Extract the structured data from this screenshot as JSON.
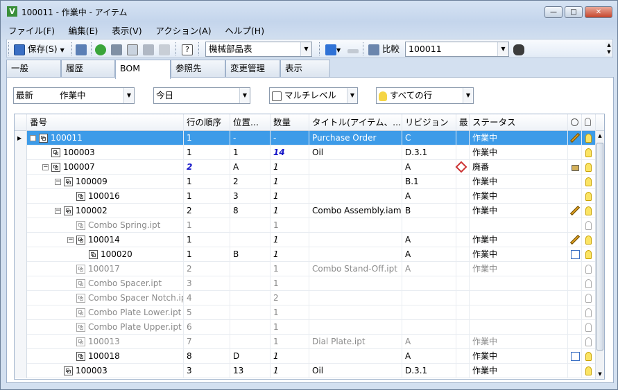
{
  "window": {
    "title": "100011 - 作業中 - アイテム",
    "app_icon": "V",
    "minimize": "—",
    "maximize": "□",
    "close": "✕"
  },
  "menu": [
    "ファイル(F)",
    "編集(E)",
    "表示(V)",
    "アクション(A)",
    "ヘルプ(H)"
  ],
  "toolbar": {
    "save_label": "保存(S)",
    "bom_view": "機械部品表",
    "compare_label": "比較",
    "compare_value": "100011"
  },
  "tabs": [
    "一般",
    "履歴",
    "BOM",
    "参照先",
    "変更管理",
    "表示"
  ],
  "active_tab": "BOM",
  "filters": {
    "revision": "最新",
    "state": "作業中",
    "date": "今日",
    "level": "マルチレベル",
    "rows": "すべての行"
  },
  "columns": [
    "番号",
    "行の順序",
    "位置...",
    "数量",
    "タイトル(アイテム、...",
    "リビジョン",
    "最",
    "ステータス"
  ],
  "rows": [
    {
      "number": "100011",
      "order": "1",
      "pos": "-",
      "qty": "-",
      "title": "Purchase Order",
      "rev": "C",
      "status": "作業中",
      "level": 0,
      "expand": "⊟",
      "selected": true,
      "style": "normal",
      "edit": true,
      "bulb": "on"
    },
    {
      "number": "100003",
      "order": "1",
      "pos": "1",
      "qty": "14",
      "title": "Oil",
      "rev": "D.3.1",
      "status": "作業中",
      "level": 1,
      "expand": "",
      "style": "normal",
      "qty_style": "blue",
      "bulb": "on"
    },
    {
      "number": "100007",
      "order": "2",
      "pos": "A",
      "qty": "1",
      "title": "",
      "rev": "A",
      "status": "廃番",
      "level": 1,
      "expand": "⊟",
      "style": "normal",
      "order_style": "blue",
      "obsolete": true,
      "lock": true,
      "bulb": "on"
    },
    {
      "number": "100009",
      "order": "1",
      "pos": "2",
      "qty": "1",
      "title": "",
      "rev": "B.1",
      "status": "作業中",
      "level": 2,
      "expand": "⊟",
      "style": "normal",
      "bulb": "on"
    },
    {
      "number": "100016",
      "order": "1",
      "pos": "3",
      "qty": "1",
      "title": "",
      "rev": "A",
      "status": "作業中",
      "level": 3,
      "expand": "",
      "style": "normal",
      "bulb": "on"
    },
    {
      "number": "100002",
      "order": "2",
      "pos": "8",
      "qty": "1",
      "title": "Combo Assembly.iam",
      "rev": "B",
      "status": "作業中",
      "level": 2,
      "expand": "⊟",
      "style": "normal",
      "edit": true,
      "bulb": "on"
    },
    {
      "number": "Combo Spring.ipt",
      "order": "1",
      "pos": "",
      "qty": "1",
      "title": "",
      "rev": "",
      "status": "",
      "level": 3,
      "expand": "",
      "style": "grey",
      "bulb": "off"
    },
    {
      "number": "100014",
      "order": "1",
      "pos": "",
      "qty": "1",
      "title": "",
      "rev": "A",
      "status": "作業中",
      "level": 3,
      "expand": "⊟",
      "style": "normal",
      "edit": true,
      "bulb": "on"
    },
    {
      "number": "100020",
      "order": "1",
      "pos": "B",
      "qty": "1",
      "title": "",
      "rev": "A",
      "status": "作業中",
      "level": 4,
      "expand": "",
      "style": "normal",
      "add": true,
      "bulb": "on"
    },
    {
      "number": "100017",
      "order": "2",
      "pos": "",
      "qty": "1",
      "title": "Combo Stand-Off.ipt",
      "rev": "A",
      "status": "作業中",
      "level": 3,
      "expand": "",
      "style": "grey",
      "bulb": "off"
    },
    {
      "number": "Combo Spacer.ipt",
      "order": "3",
      "pos": "",
      "qty": "1",
      "title": "",
      "rev": "",
      "status": "",
      "level": 3,
      "expand": "",
      "style": "grey",
      "bulb": "off"
    },
    {
      "number": "Combo Spacer Notch.ipt",
      "order": "4",
      "pos": "",
      "qty": "2",
      "title": "",
      "rev": "",
      "status": "",
      "level": 3,
      "expand": "",
      "style": "grey",
      "bulb": "off"
    },
    {
      "number": "Combo Plate Lower.ipt",
      "order": "5",
      "pos": "",
      "qty": "1",
      "title": "",
      "rev": "",
      "status": "",
      "level": 3,
      "expand": "",
      "style": "grey",
      "bulb": "off"
    },
    {
      "number": "Combo Plate Upper.ipt",
      "order": "6",
      "pos": "",
      "qty": "1",
      "title": "",
      "rev": "",
      "status": "",
      "level": 3,
      "expand": "",
      "style": "grey",
      "bulb": "off"
    },
    {
      "number": "100013",
      "order": "7",
      "pos": "",
      "qty": "1",
      "title": "Dial Plate.ipt",
      "rev": "A",
      "status": "作業中",
      "level": 3,
      "expand": "",
      "style": "grey",
      "bulb": "off"
    },
    {
      "number": "100018",
      "order": "8",
      "pos": "D",
      "qty": "1",
      "title": "",
      "rev": "A",
      "status": "作業中",
      "level": 3,
      "expand": "",
      "style": "normal",
      "add": true,
      "bulb": "on"
    },
    {
      "number": "100003",
      "order": "3",
      "pos": "13",
      "qty": "1",
      "title": "Oil",
      "rev": "D.3.1",
      "status": "作業中",
      "level": 2,
      "expand": "",
      "style": "normal",
      "bulb": "on"
    }
  ]
}
